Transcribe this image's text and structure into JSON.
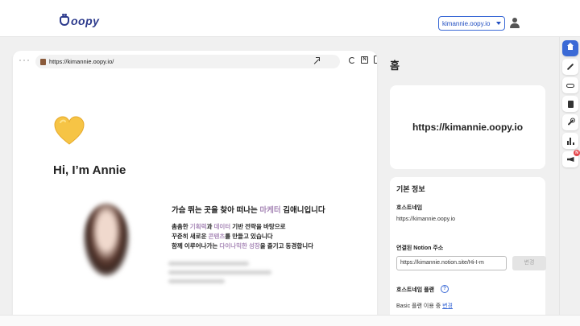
{
  "header": {
    "logo_text": "oopy",
    "domain_selector": "kimannie.oopy.io"
  },
  "preview": {
    "url": "https://kimannie.oopy.io/",
    "page_title": "Hi, I’m Annie",
    "bio_line1_a": "가슴 뛰는 곳을 찾아 떠나는 ",
    "bio_line1_hl": "마케터",
    "bio_line1_b": " 김애니입니다",
    "bio_line2_a": "촘촘한 ",
    "bio_line2_hl1": "기획력",
    "bio_line2_b": "과 ",
    "bio_line2_hl2": "데이터",
    "bio_line2_c": " 기반 전략을 바탕으로",
    "bio_line3_a": "꾸준히 새로운 ",
    "bio_line3_hl": "콘텐츠",
    "bio_line3_b": "를 만들고 있습니다",
    "bio_line4_a": "함께 이루어나가는 ",
    "bio_line4_hl1": "다이나믹한",
    "bio_line4_b": " ",
    "bio_line4_hl2": "성장",
    "bio_line4_c": "을 즐기고 동경합니다"
  },
  "panel": {
    "title": "홈",
    "site_url": "https://kimannie.oopy.io",
    "info_title": "기본 정보",
    "hostname_label": "호스트네임",
    "hostname_value": "https://kimannie.oopy.io",
    "notion_label": "연결된 Notion 주소",
    "notion_value": "https://kimannie.notion.site/Hi-I-m",
    "change_button": "변경",
    "plan_label": "호스트네임 플랜",
    "plan_text": "Basic 플랜 이용 중",
    "plan_link": "변경"
  },
  "rail": {
    "badge_text": "N",
    "items": [
      "home-icon",
      "magic-wand-icon",
      "link-icon",
      "document-icon",
      "wrench-icon",
      "bar-chart-icon",
      "megaphone-icon"
    ]
  },
  "colors": {
    "accent": "#3b6ad6",
    "highlight": "#a98ab8",
    "badge": "#e5484d"
  }
}
